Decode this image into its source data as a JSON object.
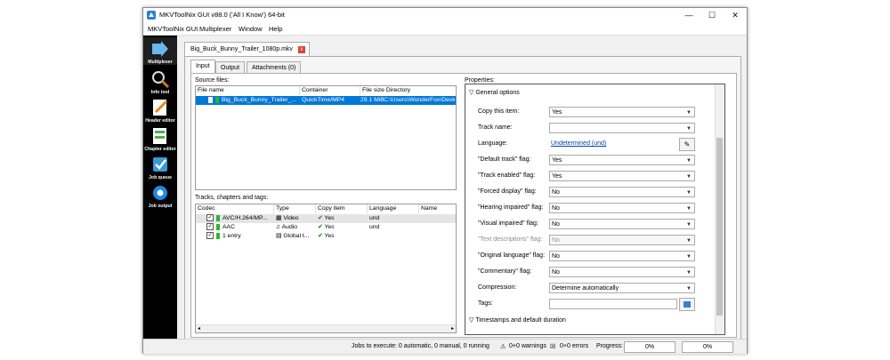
{
  "window": {
    "title": "MKVToolNix GUI v88.0 ('All I Know') 64-bit",
    "controls": {
      "minimize": "—",
      "maximize": "☐",
      "close": "✕"
    }
  },
  "menu": [
    "MKVToolNix GUI",
    "Multiplexer",
    "Window",
    "Help"
  ],
  "sidebar": [
    {
      "label": "Multiplexer",
      "icon": "multiplexer-icon"
    },
    {
      "label": "Info tool",
      "icon": "info-tool-icon"
    },
    {
      "label": "Header editor",
      "icon": "header-editor-icon"
    },
    {
      "label": "Chapter editor",
      "icon": "chapter-editor-icon"
    },
    {
      "label": "Job queue",
      "icon": "job-queue-icon"
    },
    {
      "label": "Job output",
      "icon": "job-output-icon"
    }
  ],
  "file_tab": {
    "label": "Big_Buck_Bunny_Trailer_1080p.mkv",
    "close": "x"
  },
  "sub_tabs": [
    "Input",
    "Output",
    "Attachments (0)"
  ],
  "source_files": {
    "label": "Source files:",
    "columns": [
      "File name",
      "Container",
      "File size",
      "Directory"
    ],
    "rows": [
      {
        "name": "Big_Buck_Bunny_Trailer_...",
        "container": "QuickTime/MP4",
        "size": "29.1 MiB",
        "directory": "C:\\Users\\WonderFox\\Desk..."
      }
    ]
  },
  "tracks": {
    "label": "Tracks, chapters and tags:",
    "columns": [
      "Codec",
      "Type",
      "Copy item",
      "Language",
      "Name"
    ],
    "rows": [
      {
        "codec": "AVC/H.264/MP...",
        "type": "Video",
        "copy": "Yes",
        "language": "und"
      },
      {
        "codec": "AAC",
        "type": "Audio",
        "copy": "Yes",
        "language": "und"
      },
      {
        "codec": "1 entry",
        "type": "Global t...",
        "copy": "Yes",
        "language": ""
      }
    ]
  },
  "properties": {
    "label": "Properties:",
    "section_general": "General options",
    "section_timestamps": "Timestamps and default duration",
    "fields": [
      {
        "label": "Copy this item:",
        "value": "Yes"
      },
      {
        "label": "Track name:",
        "value": ""
      },
      {
        "label": "Language:",
        "value": "Undetermined (und)"
      },
      {
        "label": "\"Default track\" flag:",
        "value": "Yes"
      },
      {
        "label": "\"Track enabled\" flag:",
        "value": "Yes"
      },
      {
        "label": "\"Forced display\" flag:",
        "value": "No"
      },
      {
        "label": "\"Hearing impaired\" flag:",
        "value": "No"
      },
      {
        "label": "\"Visual impaired\" flag:",
        "value": "No"
      },
      {
        "label": "\"Text descriptions\" flag:",
        "value": "No"
      },
      {
        "label": "\"Original language\" flag:",
        "value": "No"
      },
      {
        "label": "\"Commentary\" flag:",
        "value": "No"
      },
      {
        "label": "Compression:",
        "value": "Determine automatically"
      },
      {
        "label": "Tags:",
        "value": ""
      }
    ]
  },
  "status": {
    "jobs": "Jobs to execute:  0 automatic, 0 manual, 0 running",
    "warnings": "0+0 warnings",
    "errors": "0+0 errors",
    "progress_label": "Progress:",
    "progress1": "0%",
    "progress2": "0%"
  },
  "colors": {
    "selection": "#0078d7",
    "sidebar_bg": "#000000",
    "link": "#0645ad"
  }
}
